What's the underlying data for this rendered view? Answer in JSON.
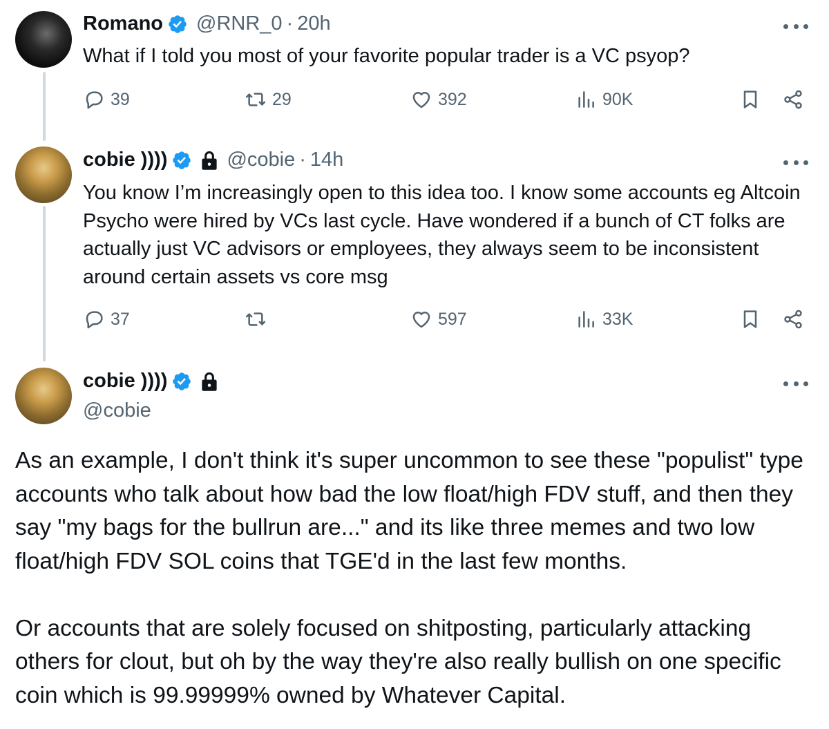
{
  "tweets": [
    {
      "name": "Romano",
      "handle": "@RNR_0",
      "time": "20h",
      "text": "What if I told you most of your favorite popular trader is a VC psyop?",
      "replies": "39",
      "retweets": "29",
      "likes": "392",
      "views": "90K"
    },
    {
      "name": "cobie ))))",
      "handle": "@cobie",
      "time": "14h",
      "text": "You know I’m increasingly open to this idea too. I know some accounts eg Altcoin Psycho were hired by VCs last cycle. Have wondered if a bunch of CT folks are actually just VC advisors or employees, they always seem to be inconsistent around certain assets vs core msg",
      "replies": "37",
      "retweets": "",
      "likes": "597",
      "views": "33K"
    }
  ],
  "main_tweet": {
    "name": "cobie ))))",
    "handle": "@cobie",
    "paragraph1": "As an example, I don't think it's super uncommon to see these \"populist\" type accounts who talk about how bad the low float/high FDV stuff, and then they say \"my bags for the bullrun are...\" and its like three memes and two low float/high FDV SOL coins that TGE'd in the last few months.",
    "paragraph2": "Or accounts that are solely focused on shitposting, particularly attacking others for clout, but oh by the way they're also really bullish on one specific coin which is 99.99999% owned by Whatever Capital."
  },
  "separator": "·",
  "icons": {
    "reply": "reply-icon",
    "retweet": "retweet-icon",
    "like": "heart-icon",
    "views": "views-icon",
    "bookmark": "bookmark-icon",
    "share": "share-icon",
    "verified": "verified-badge-icon",
    "protected": "lock-icon",
    "more": "more-icon"
  },
  "colors": {
    "verified": "#1d9bf0",
    "secondary_text": "#536471",
    "thread_line": "#cfd9de"
  }
}
